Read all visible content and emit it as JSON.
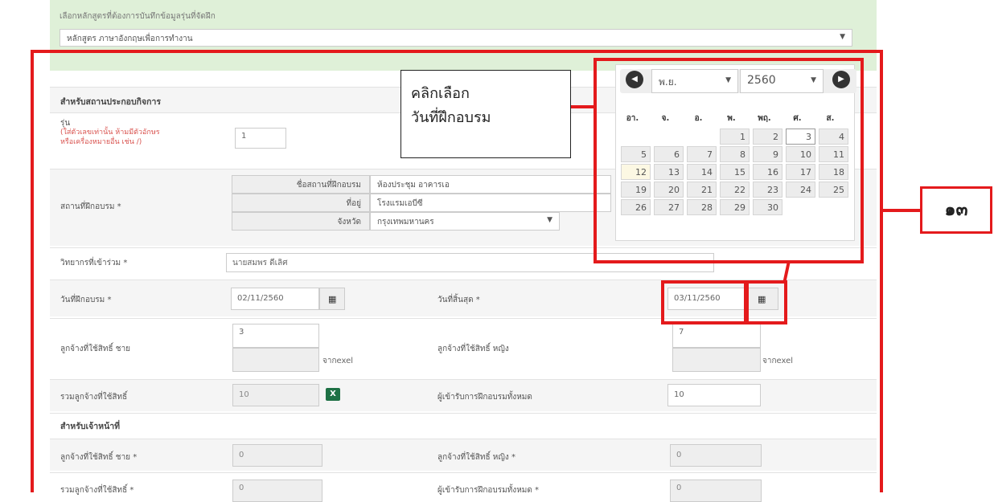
{
  "top": {
    "label": "เลือกหลักสูตรที่ต้องการบันทึกข้อมูลรุ่นที่จัดฝึก",
    "course": "หลักสูตร ภาษาอังกฤษเพื่อการทำงาน",
    "caret": "▼"
  },
  "form": {
    "section_company": "สำหรับสถานประกอบกิจการ",
    "batch_label": "รุ่น",
    "batch_hint_1": "(ใส่ตัวเลขเท่านั้น ห้ามมีตัวอักษร",
    "batch_hint_2": "หรือเครื่องหมายอื่น เช่น /)",
    "batch_value": "1",
    "venue_label": "สถานที่ฝึกอบรม *",
    "venue_name_label": "ชื่อสถานที่ฝึกอบรม",
    "venue_name_value": "ห้องประชุม อาคารเอ",
    "venue_addr_label": "ที่อยู่",
    "venue_addr_value": "โรงแรมเอบีซี",
    "venue_prov_label": "จังหวัด",
    "venue_prov_value": "กรุงเทพมหานคร",
    "trainer_label": "วิทยากรที่เข้าร่วม *",
    "trainer_value": "นายสมพร ดีเลิศ",
    "start_label": "วันที่ฝึกอบรม *",
    "start_value": "02/11/2560",
    "end_label": "วันที่สิ้นสุด *",
    "end_value": "03/11/2560",
    "male_label": "ลูกจ้างที่ใช้สิทธิ์ ชาย",
    "male_value": "3",
    "female_label": "ลูกจ้างที่ใช้สิทธิ์ หญิง",
    "female_value": "7",
    "from_excel": "จากexel",
    "total_label": "รวมลูกจ้างที่ใช้สิทธิ์",
    "total_value": "10",
    "all_trainees_label": "ผู้เข้ารับการฝึกอบรมทั้งหมด",
    "all_trainees_value": "10",
    "section_staff": "สำหรับเจ้าหน้าที่",
    "staff_male_label": "ลูกจ้างที่ใช้สิทธิ์ ชาย *",
    "staff_male_value": "0",
    "staff_female_label": "ลูกจ้างที่ใช้สิทธิ์ หญิง *",
    "staff_female_value": "0",
    "staff_total_label": "รวมลูกจ้างที่ใช้สิทธิ์ *",
    "staff_total_value": "0",
    "staff_all_label": "ผู้เข้ารับการฝึกอบรมทั้งหมด *",
    "staff_all_value": "0"
  },
  "calendar": {
    "month": "พ.ย.",
    "year": "2560",
    "weekdays": [
      "อา.",
      "จ.",
      "อ.",
      "พ.",
      "พฤ.",
      "ศ.",
      "ส."
    ],
    "rows": [
      [
        "",
        "",
        "",
        "1",
        "2",
        "3",
        "4"
      ],
      [
        "5",
        "6",
        "7",
        "8",
        "9",
        "10",
        "11"
      ],
      [
        "12",
        "13",
        "14",
        "15",
        "16",
        "17",
        "18"
      ],
      [
        "19",
        "20",
        "21",
        "22",
        "23",
        "24",
        "25"
      ],
      [
        "26",
        "27",
        "28",
        "29",
        "30",
        "",
        ""
      ]
    ],
    "today": "12",
    "selected": "3"
  },
  "annotation": {
    "callout_line1": "คลิกเลือก",
    "callout_line2": "วันที่ฝึกอบรม",
    "step": "๑๓"
  },
  "colors": {
    "highlight_red": "#e41a1c",
    "panel_green": "#dff0d8"
  }
}
